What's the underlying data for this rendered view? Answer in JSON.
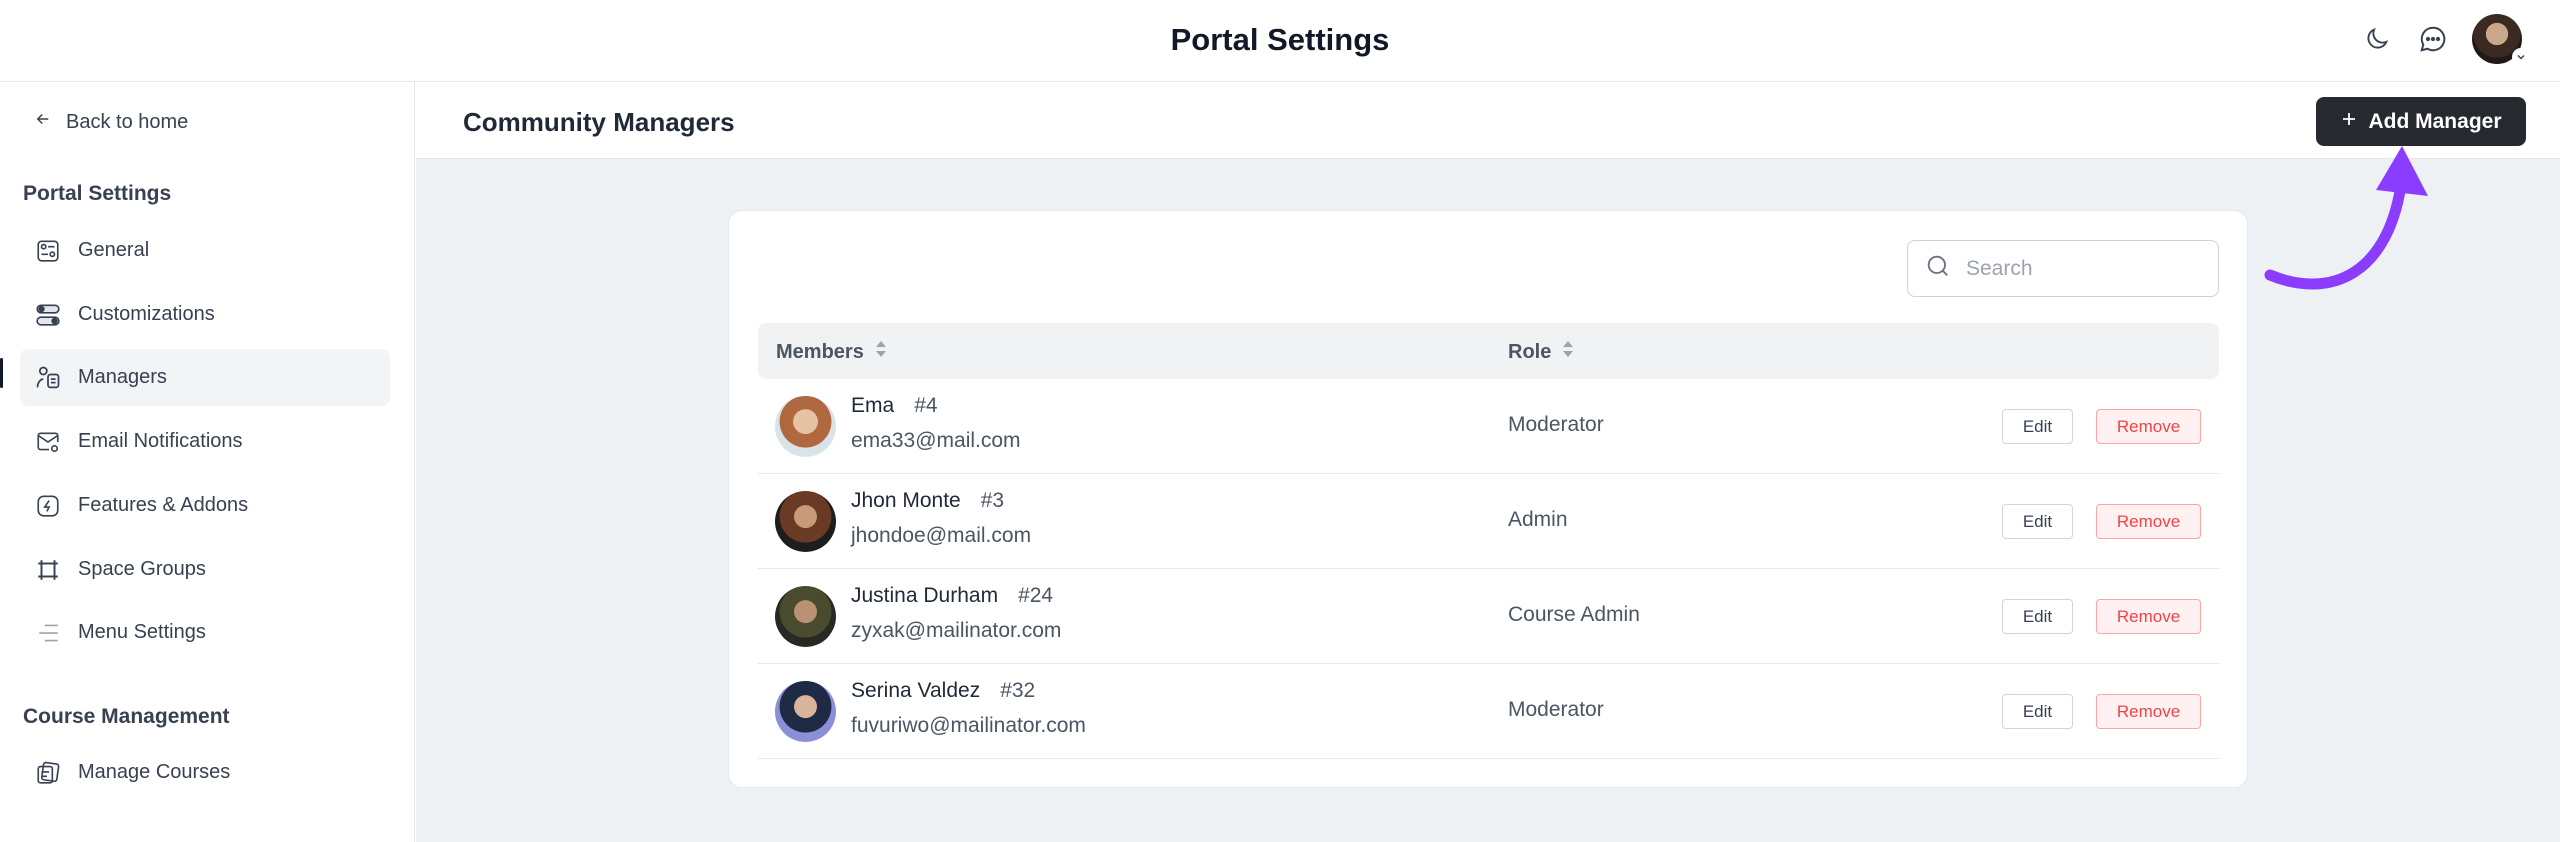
{
  "header": {
    "title": "Portal Settings"
  },
  "sidebar": {
    "back_label": "Back to home",
    "section1_title": "Portal Settings",
    "items": [
      {
        "label": "General",
        "icon": "sliders-icon"
      },
      {
        "label": "Customizations",
        "icon": "toggle-icon"
      },
      {
        "label": "Managers",
        "icon": "managers-icon",
        "active": true
      },
      {
        "label": "Email Notifications",
        "icon": "mail-settings-icon"
      },
      {
        "label": "Features & Addons",
        "icon": "feature-icon"
      },
      {
        "label": "Space Groups",
        "icon": "frame-icon"
      },
      {
        "label": "Menu Settings",
        "icon": "menu-lines-icon"
      }
    ],
    "section2_title": "Course Management",
    "items2": [
      {
        "label": "Manage Courses",
        "icon": "courses-icon"
      }
    ]
  },
  "main": {
    "page_title": "Community Managers",
    "add_button": "Add Manager",
    "search_placeholder": "Search",
    "columns": {
      "members": "Members",
      "role": "Role"
    },
    "rows": [
      {
        "name": "Ema",
        "uid": "#4",
        "email": "ema33@mail.com",
        "role": "Moderator",
        "edit": "Edit",
        "remove": "Remove"
      },
      {
        "name": "Jhon Monte",
        "uid": "#3",
        "email": "jhondoe@mail.com",
        "role": "Admin",
        "edit": "Edit",
        "remove": "Remove"
      },
      {
        "name": "Justina Durham",
        "uid": "#24",
        "email": "zyxak@mailinator.com",
        "role": "Course Admin",
        "edit": "Edit",
        "remove": "Remove"
      },
      {
        "name": "Serina Valdez",
        "uid": "#32",
        "email": "fuvuriwo@mailinator.com",
        "role": "Moderator",
        "edit": "Edit",
        "remove": "Remove"
      }
    ]
  },
  "colors": {
    "accent_arrow": "#8b3dff",
    "primary_button": "#262a30",
    "danger": "#ef4444"
  }
}
